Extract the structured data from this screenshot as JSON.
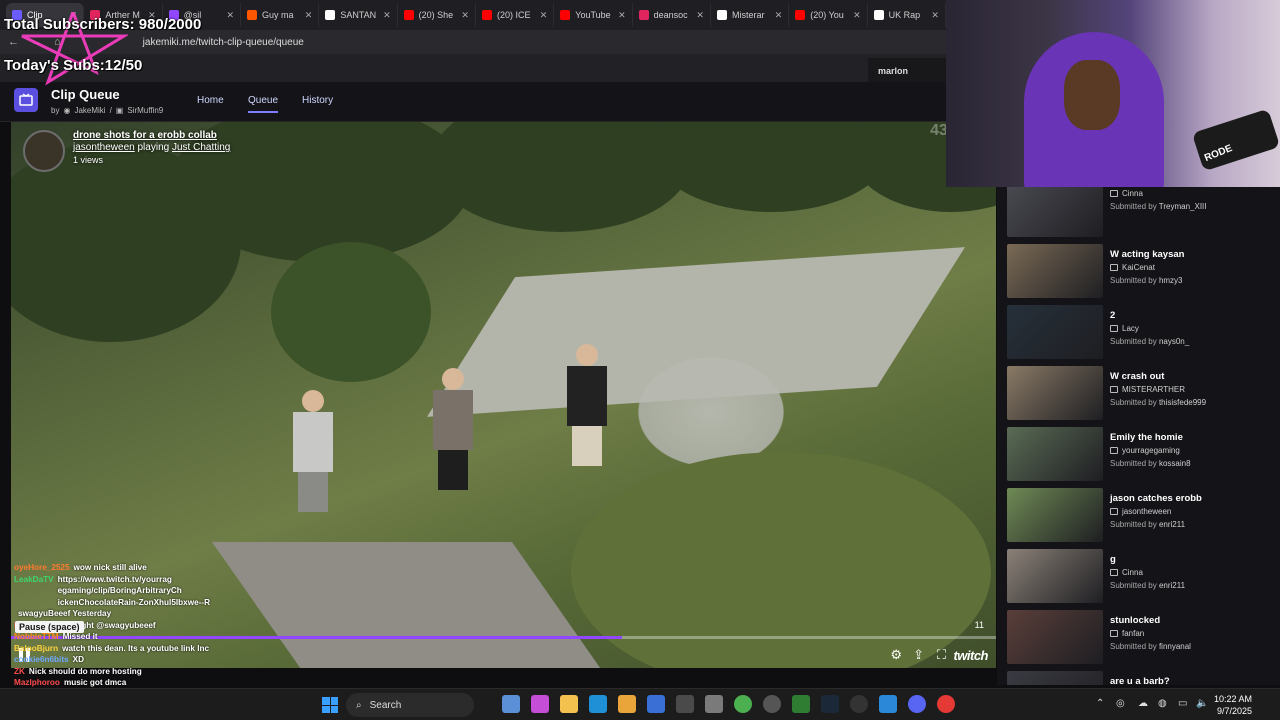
{
  "browser": {
    "tabs": [
      {
        "label": "Clip",
        "color": "#6b5cff",
        "active": true
      },
      {
        "label": "Arther M",
        "color": "#e0245e"
      },
      {
        "label": "@sil",
        "color": "#9147ff"
      },
      {
        "label": "Guy ma",
        "color": "#ff5700"
      },
      {
        "label": "SANTAN",
        "color": "#ffffff"
      },
      {
        "label": "(20) She",
        "color": "#ff0000"
      },
      {
        "label": "(20) ICE",
        "color": "#ff0000"
      },
      {
        "label": "YouTube",
        "color": "#ff0000"
      },
      {
        "label": "deansoc",
        "color": "#e0245e"
      },
      {
        "label": "Misterar",
        "color": "#ffffff"
      },
      {
        "label": "(20) You",
        "color": "#ff0000"
      },
      {
        "label": "UK Rap",
        "color": "#ffffff"
      }
    ],
    "url": "jakemiki.me/twitch-clip-queue/queue",
    "profile_pill": "marlon"
  },
  "overlay": {
    "total_subs": "Total Subscribers: 980/2000",
    "today_subs": "Today's Subs:12/50"
  },
  "app": {
    "title": "Clip Queue",
    "by": "by",
    "author1": "JakeMiki",
    "separator": "/",
    "author2": "SirMuffin9",
    "nav": {
      "home": "Home",
      "queue": "Queue",
      "history": "History"
    }
  },
  "player": {
    "clip_title": "drone shots for a erobb collab",
    "channel": "jasontheween",
    "playing_prefix": "playing",
    "category": "Just Chatting",
    "views": "1 views",
    "viewcount": "43420/4",
    "time": "11",
    "progress": 0.62,
    "brand": "twitch",
    "pause_tooltip": "Pause (space)"
  },
  "chat": [
    {
      "user": "oyeHore_2525",
      "color": "#ff7a2f",
      "text": "wow nick still alive"
    },
    {
      "user": "LeakDaTV",
      "color": "#3fd66b",
      "text": "https://www.twitch.tv/yourrag egaming/clip/BoringArbitraryCh ickenChocolateRain-ZonXhul5lbxwe--R"
    },
    {
      "user": "",
      "color": "#ffffff",
      "text": "swagyuBeeef Yesterday"
    },
    {
      "user": "Ramatiinn",
      "color": "#ff4b4b",
      "text": "last night @swagyubeeef"
    },
    {
      "user": "NobbleTTM",
      "color": "#ff8c1a",
      "text": "Missed it"
    },
    {
      "user": "BalooBjurn",
      "color": "#ffd23f",
      "text": "watch this dean. Its a youtube link Inc"
    },
    {
      "user": "cookie6n6bits",
      "color": "#6ea8ff",
      "text": "XD"
    },
    {
      "user": "ZK",
      "color": "#ff4b4b",
      "text": "Nick should do more hosting"
    },
    {
      "user": "Mazlphoroo",
      "color": "#ff4b4b",
      "text": "music got dmca"
    }
  ],
  "queue": [
    {
      "title": "",
      "channel": "Cinna",
      "submitter": "Treyman_XIII",
      "thumb": "#4a4a52"
    },
    {
      "title": "W acting kaysan",
      "channel": "KaiCenat",
      "submitter": "hmzy3",
      "thumb": "#7a6a55"
    },
    {
      "title": "2",
      "channel": "Lacy",
      "submitter": "nays0n_",
      "thumb": "#26303a"
    },
    {
      "title": "W crash out",
      "channel": "MISTERARTHER",
      "submitter": "thisisfede999",
      "thumb": "#8a7a66"
    },
    {
      "title": "Emily the homie",
      "channel": "yourragegaming",
      "submitter": "kossain8",
      "thumb": "#5a6b55"
    },
    {
      "title": "jason catches erobb",
      "channel": "jasontheween",
      "submitter": "enri211",
      "thumb": "#6f8a55"
    },
    {
      "title": "g",
      "channel": "Cinna",
      "submitter": "enri211",
      "thumb": "#8b8178"
    },
    {
      "title": "stunlocked",
      "channel": "fanfan",
      "submitter": "finnyanal",
      "thumb": "#5a3f3a"
    },
    {
      "title": "are u a barb?",
      "channel": "",
      "submitter": "",
      "thumb": "#3a3a42"
    }
  ],
  "queue_submitted_prefix": "Submitted by",
  "taskbar": {
    "search_placeholder": "Search",
    "time": "10:22 AM",
    "date": "9/7/2025"
  }
}
